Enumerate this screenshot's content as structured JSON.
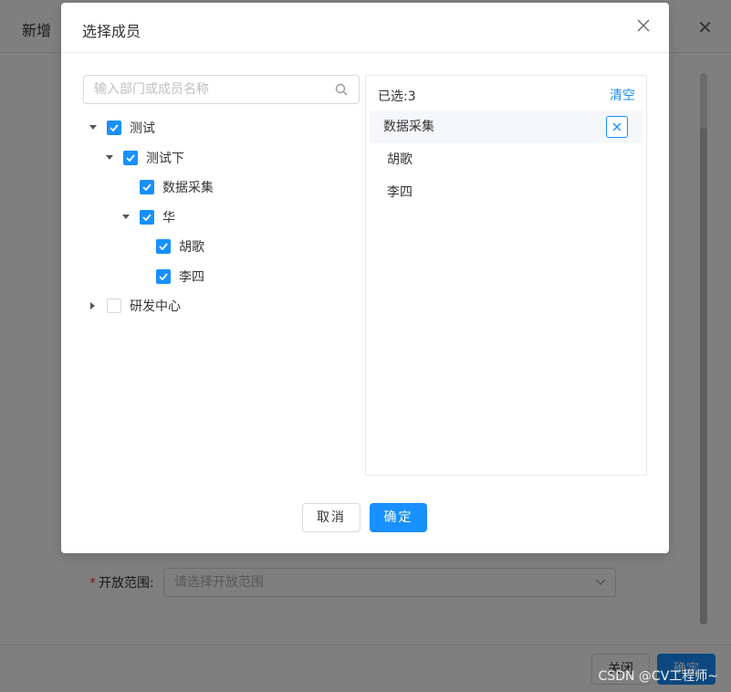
{
  "background": {
    "title": "新增",
    "field_label": "开放范围:",
    "field_placeholder": "请选择开放范围",
    "close_label": "关闭",
    "ok_label": "确定"
  },
  "modal": {
    "title": "选择成员",
    "search_placeholder": "输入部门或成员名称",
    "tree": [
      {
        "label": "测试",
        "depth": 0,
        "caret": "down",
        "checked": true
      },
      {
        "label": "测试下",
        "depth": 1,
        "caret": "down",
        "checked": true
      },
      {
        "label": "数据采集",
        "depth": 2,
        "caret": "none",
        "checked": true
      },
      {
        "label": "华",
        "depth": 2,
        "caret": "down",
        "checked": true
      },
      {
        "label": "胡歌",
        "depth": 3,
        "caret": "none",
        "checked": true
      },
      {
        "label": "李四",
        "depth": 3,
        "caret": "none",
        "checked": true
      },
      {
        "label": "研发中心",
        "depth": 0,
        "caret": "right",
        "checked": false
      }
    ],
    "selected_label": "已选:3",
    "clear_label": "清空",
    "selected": [
      "数据采集",
      "胡歌",
      "李四"
    ],
    "cancel_label": "取消",
    "confirm_label": "确定"
  },
  "watermark": "CSDN @CV工程师~",
  "colors": {
    "primary": "#1890ff",
    "mask": "rgba(0,0,0,0.5)"
  }
}
